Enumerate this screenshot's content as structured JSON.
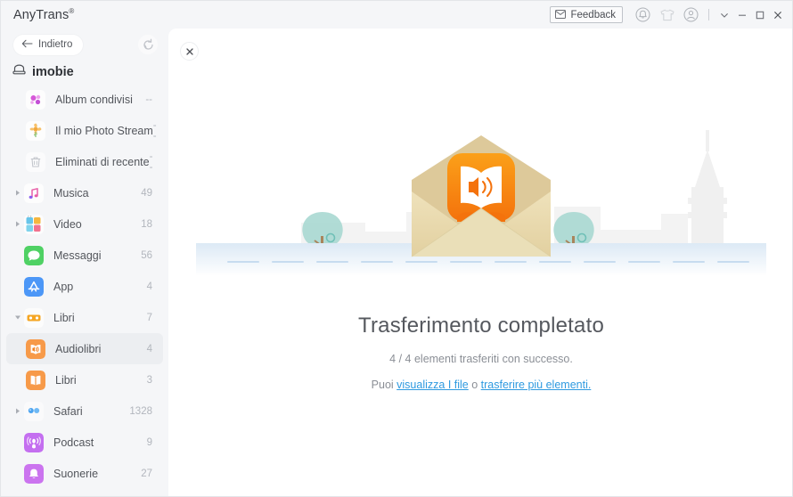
{
  "titlebar": {
    "app_title": "AnyTrans",
    "app_title_mark": "®",
    "feedback_label": "Feedback",
    "feedback_icon": "envelope-icon",
    "icons": [
      {
        "name": "bell-icon",
        "label": "Notifiche"
      },
      {
        "name": "tshirt-icon",
        "label": "Temi"
      },
      {
        "name": "account-icon",
        "label": "Account"
      }
    ],
    "window_controls": [
      {
        "name": "chevron-down-icon",
        "glyph": "∨"
      },
      {
        "name": "minimize-icon",
        "glyph": "─"
      },
      {
        "name": "maximize-icon",
        "glyph": "□"
      },
      {
        "name": "close-icon",
        "glyph": "✕"
      }
    ]
  },
  "sidebar": {
    "back_label": "Indietro",
    "back_icon": "arrow-left-icon",
    "refresh_icon": "refresh-icon",
    "device_icon": "device-icon",
    "device_name": "imobie",
    "items": [
      {
        "label": "Album condivisi",
        "count": "--",
        "icon": "shared-albums-icon",
        "level": 1,
        "expander": "none",
        "selected": false
      },
      {
        "label": "Il mio Photo Stream",
        "count": "--",
        "icon": "photo-stream-icon",
        "level": 1,
        "expander": "none",
        "selected": false
      },
      {
        "label": "Eliminati di recente",
        "count": "--",
        "icon": "trash-icon",
        "level": 1,
        "expander": "none",
        "selected": false
      },
      {
        "label": "Musica",
        "count": "49",
        "icon": "music-icon",
        "level": 0,
        "expander": "right",
        "selected": false
      },
      {
        "label": "Video",
        "count": "18",
        "icon": "video-icon",
        "level": 0,
        "expander": "right",
        "selected": false
      },
      {
        "label": "Messaggi",
        "count": "56",
        "icon": "messages-icon",
        "level": 0,
        "expander": "none",
        "selected": false
      },
      {
        "label": "App",
        "count": "4",
        "icon": "appstore-icon",
        "level": 0,
        "expander": "none",
        "selected": false
      },
      {
        "label": "Libri",
        "count": "7",
        "icon": "books-group-icon",
        "level": 0,
        "expander": "down",
        "selected": false
      },
      {
        "label": "Audiolibri",
        "count": "4",
        "icon": "audiobook-icon",
        "level": 1,
        "expander": "none",
        "selected": true
      },
      {
        "label": "Libri",
        "count": "3",
        "icon": "book-icon",
        "level": 1,
        "expander": "none",
        "selected": false
      },
      {
        "label": "Safari",
        "count": "1328",
        "icon": "safari-icon",
        "level": 0,
        "expander": "right",
        "selected": false
      },
      {
        "label": "Podcast",
        "count": "9",
        "icon": "podcast-icon",
        "level": 0,
        "expander": "none",
        "selected": false
      },
      {
        "label": "Suonerie",
        "count": "27",
        "icon": "ringtone-icon",
        "level": 0,
        "expander": "none",
        "selected": false
      }
    ]
  },
  "content": {
    "close_icon": "close-icon",
    "illustration": "envelope-audiobook-illustration",
    "title": "Trasferimento completato",
    "subtitle": "4 / 4 elementi trasferiti con successo.",
    "links_prefix": "Puoi ",
    "link_view_files": "visualizza I file",
    "links_middle": " o ",
    "link_transfer_more": "trasferire più elementi.",
    "colors": {
      "link": "#2e9ae0",
      "accent_orange": "#f5871f",
      "envelope": "#e6d6a8",
      "tree": "#a9d8d2"
    }
  }
}
